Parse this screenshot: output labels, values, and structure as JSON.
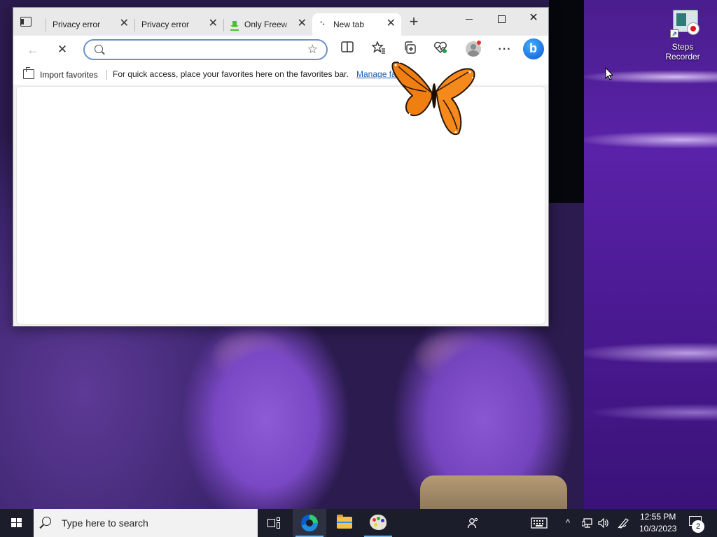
{
  "desktop": {
    "icons": [
      {
        "label": "Steps Recorder",
        "icon": "steps-recorder-icon"
      }
    ]
  },
  "browser": {
    "tabs": [
      {
        "label": "Privacy error",
        "active": false
      },
      {
        "label": "Privacy error",
        "active": false
      },
      {
        "label": "Only Freeware",
        "favicon": "download-icon",
        "active": false
      },
      {
        "label": "New tab",
        "favicon": "loading-spinner-icon",
        "active": true
      }
    ],
    "new_tab_symbol": "+",
    "window_controls": {
      "minimize": "minimize-icon",
      "maximize": "maximize-icon",
      "close": "✕"
    },
    "toolbar": {
      "back": "←",
      "stop": "✕",
      "address_value": "",
      "favorite_star": "☆",
      "split_screen": "split-screen-icon",
      "favorites": "favorites-icon",
      "collections": "collections-icon",
      "browser_essentials": "browser-essentials-icon",
      "profile": "profile-icon",
      "more": "···",
      "copilot": "bing-copilot-icon"
    },
    "favorites_bar": {
      "import_label": "Import favorites",
      "message": "For quick access, place your favorites here on the favorites bar.",
      "manage_link": "Manage favorites now"
    }
  },
  "taskbar": {
    "search_placeholder": "Type here to search",
    "pinned": [
      "task-view-icon",
      "edge-icon",
      "file-explorer-icon",
      "paint-icon"
    ],
    "tray": {
      "people": "people-icon",
      "touch_keyboard": "keyboard-icon",
      "chevron": "^",
      "network": "network-icon",
      "volume": "volume-icon",
      "pen": "pen-icon",
      "time": "12:55 PM",
      "date": "10/3/2023",
      "notifications_count": "2"
    }
  },
  "colors": {
    "accent": "#1a5fb4",
    "taskbar": "#1b1e2a",
    "address_focus": "#6b8fc9"
  }
}
